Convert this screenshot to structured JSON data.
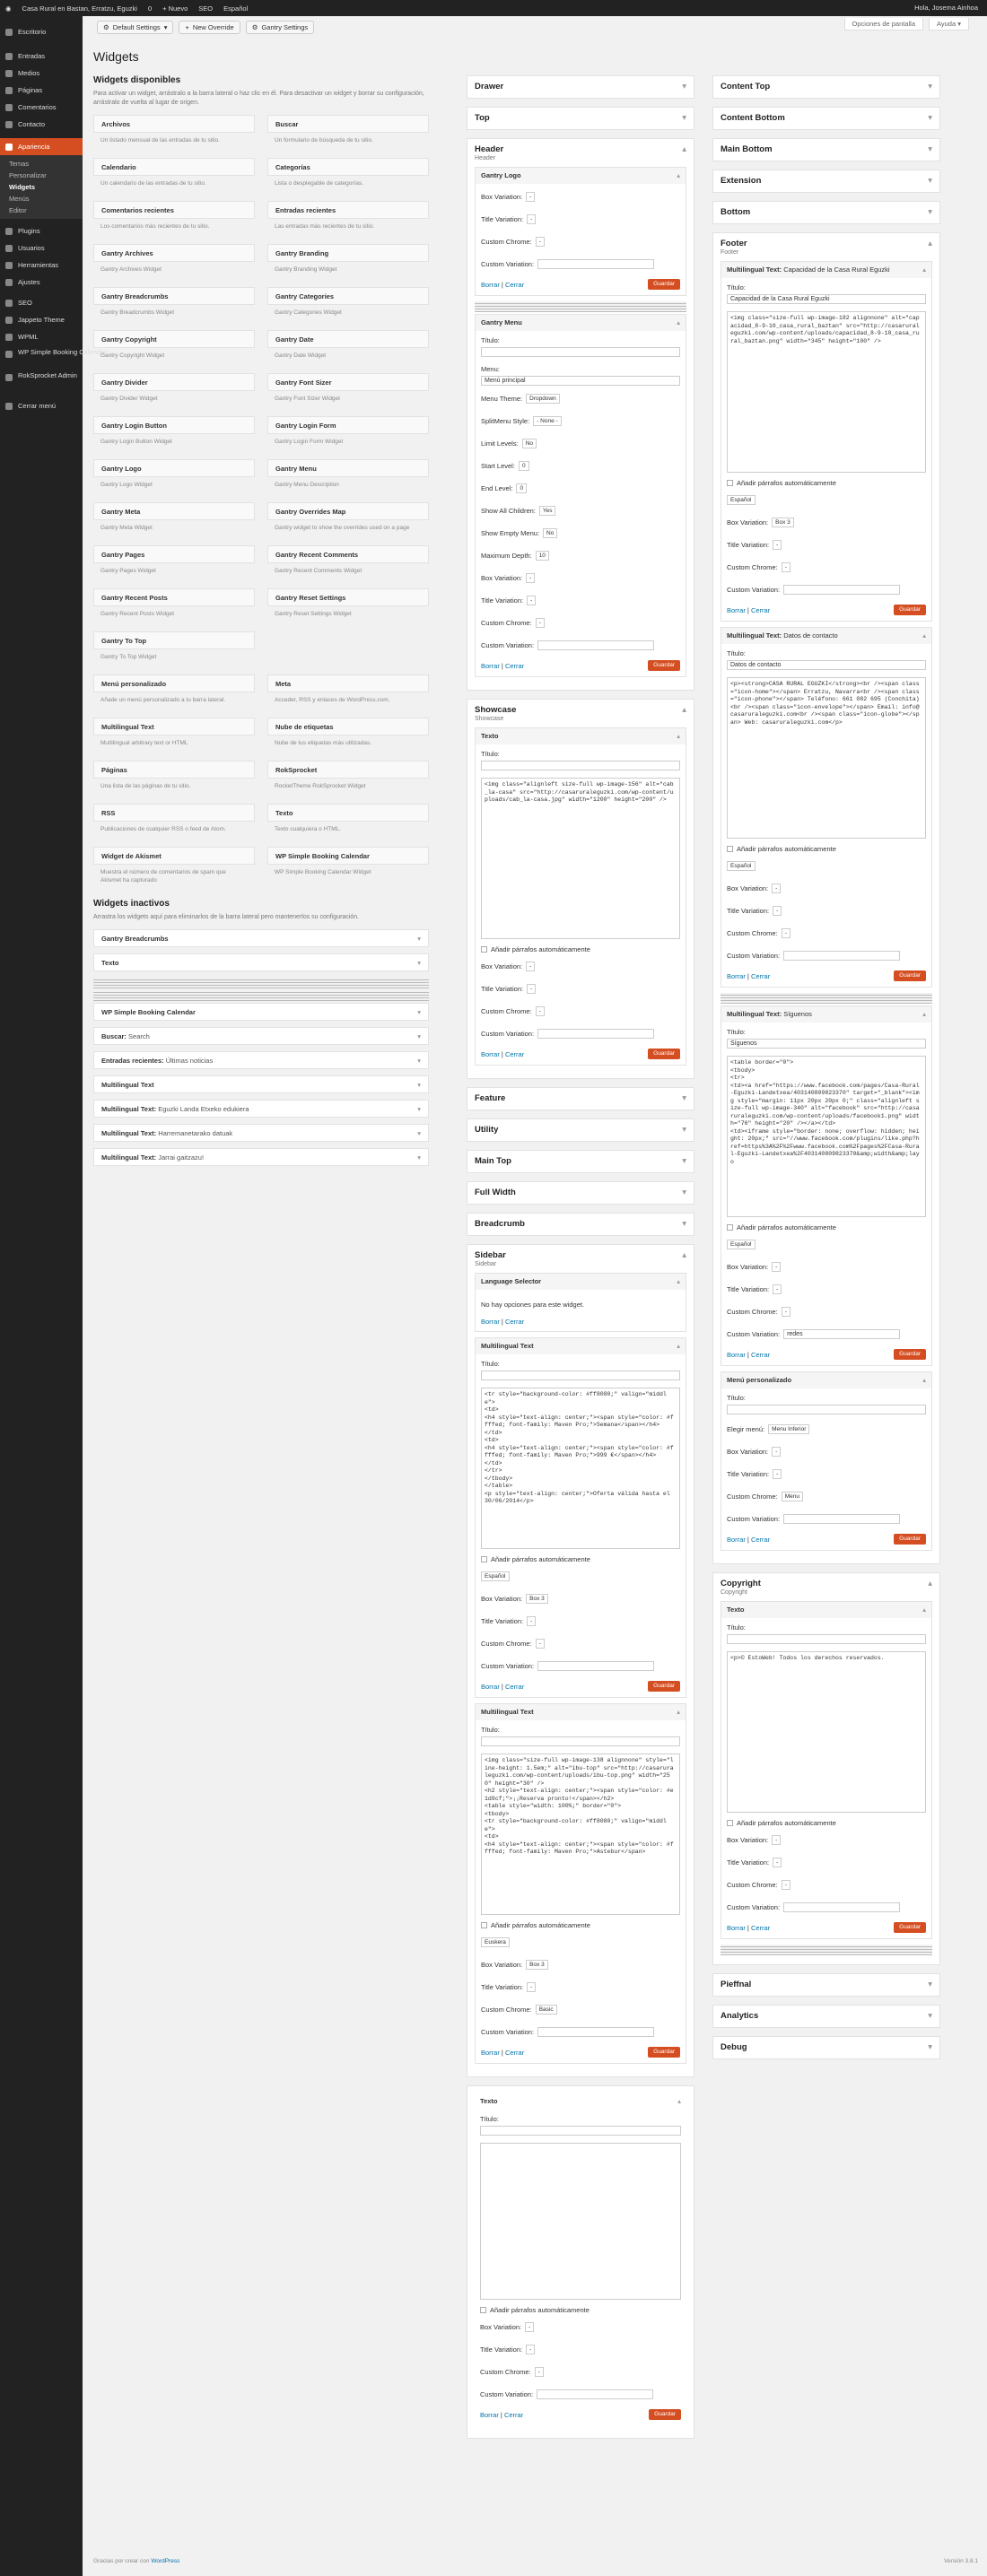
{
  "adminbar": {
    "site": "Casa Rural en Bastan, Erratzu, Eguzki",
    "comments": "0",
    "new": "+ Nuevo",
    "seo": "SEO",
    "lang": "Español",
    "howdy": "Hola, Josema Ainhoa"
  },
  "menu": [
    "Escritorio",
    "Entradas",
    "Medios",
    "Páginas",
    "Comentarios",
    "Contacto",
    "Apariencia",
    "Plugins",
    "Usuarios",
    "Herramientas",
    "Ajustes",
    "SEO",
    "Jappeto Theme",
    "WPML",
    "WP Simple Booking Calendar",
    "RokSprocket Admin",
    "Cerrar menú"
  ],
  "submenu": [
    "Temas",
    "Personalizar",
    "Widgets",
    "Menús",
    "Editor"
  ],
  "toolbar": {
    "default": "Default Settings",
    "override": "New Override",
    "gantry": "Gantry Settings"
  },
  "screen_options": "Opciones de pantalla",
  "help": "Ayuda ▾",
  "page_title": "Widgets",
  "available": {
    "heading": "Widgets disponibles",
    "desc": "Para activar un widget, arrástralo a la barra lateral o haz clic en él. Para desactivar un widget y borrar su configuración, arrástralo de vuelta al lugar de origen.",
    "items": [
      {
        "t": "Archivos",
        "d": "Un listado mensual de las entradas de tu sitio."
      },
      {
        "t": "Buscar",
        "d": "Un formulario de búsqueda de tu sitio."
      },
      {
        "t": "Calendario",
        "d": "Un calendario de las entradas de tu sitio."
      },
      {
        "t": "Categorías",
        "d": "Lista o desplegable de categorías."
      },
      {
        "t": "Comentarios recientes",
        "d": "Los comentarios más recientes de tu sitio."
      },
      {
        "t": "Entradas recientes",
        "d": "Las entradas más recientes de tu sitio."
      },
      {
        "t": "Gantry Archives",
        "d": "Gantry Archives Widget"
      },
      {
        "t": "Gantry Branding",
        "d": "Gantry Branding Widget"
      },
      {
        "t": "Gantry Breadcrumbs",
        "d": "Gantry Breadcrumbs Widget"
      },
      {
        "t": "Gantry Categories",
        "d": "Gantry Categories Widget"
      },
      {
        "t": "Gantry Copyright",
        "d": "Gantry Copyright Widget"
      },
      {
        "t": "Gantry Date",
        "d": "Gantry Date Widget"
      },
      {
        "t": "Gantry Divider",
        "d": "Gantry Divider Widget"
      },
      {
        "t": "Gantry Font Sizer",
        "d": "Gantry Font Sizer Widget"
      },
      {
        "t": "Gantry Login Button",
        "d": "Gantry Login Button Widget"
      },
      {
        "t": "Gantry Login Form",
        "d": "Gantry Login Form Widget"
      },
      {
        "t": "Gantry Logo",
        "d": "Gantry Logo Widget"
      },
      {
        "t": "Gantry Menu",
        "d": "Gantry Menu Description"
      },
      {
        "t": "Gantry Meta",
        "d": "Gantry Meta Widget"
      },
      {
        "t": "Gantry Overrides Map",
        "d": "Gantry widget to show the overrides used on a page"
      },
      {
        "t": "Gantry Pages",
        "d": "Gantry Pages Widget"
      },
      {
        "t": "Gantry Recent Comments",
        "d": "Gantry Recent Comments Widget"
      },
      {
        "t": "Gantry Recent Posts",
        "d": "Gantry Recent Posts Widget"
      },
      {
        "t": "Gantry Reset Settings",
        "d": "Gantry Reset Settings Widget"
      },
      {
        "t": "Gantry To Top",
        "d": "Gantry To Top Widget"
      },
      {
        "t": "",
        "d": ""
      },
      {
        "t": "Menú personalizado",
        "d": "Añade un menú personalizado a tu barra lateral."
      },
      {
        "t": "Meta",
        "d": "Acceder, RSS y enlaces de WordPress.com."
      },
      {
        "t": "Multilingual Text",
        "d": "Multilingual arbitrary text or HTML"
      },
      {
        "t": "Nube de etiquetas",
        "d": "Nube de tus etiquetas más utilizadas."
      },
      {
        "t": "Páginas",
        "d": "Una lista de las páginas de tu sitio."
      },
      {
        "t": "RokSprocket",
        "d": "RocketTheme RokSprocket Widget"
      },
      {
        "t": "RSS",
        "d": "Publicaciones de cualquier RSS o feed de Atom."
      },
      {
        "t": "Texto",
        "d": "Texto cualquiera o HTML."
      },
      {
        "t": "Widget de Akismet",
        "d": "Muestra el número de comentarios de spam que Akismet ha capturado"
      },
      {
        "t": "WP Simple Booking Calendar",
        "d": "WP Simple Booking Calendar Widget"
      }
    ]
  },
  "inactive": {
    "heading": "Widgets inactivos",
    "desc": "Arrastra los widgets aquí para eliminarlos de la barra lateral pero mantenerlos su configuración.",
    "items": [
      {
        "t": "Gantry Breadcrumbs",
        "s": ""
      },
      {
        "t": "Texto",
        "s": ""
      },
      {
        "t": "WP Simple Booking Calendar",
        "s": ""
      },
      {
        "t": "Buscar:",
        "s": "Search"
      },
      {
        "t": "Entradas recientes:",
        "s": "Últimas noticias"
      },
      {
        "t": "Multilingual Text",
        "s": ""
      },
      {
        "t": "Multilingual Text:",
        "s": "Eguzki Landa Etxeko edukiera"
      },
      {
        "t": "Multilingual Text:",
        "s": "Harremanetarako datuak"
      },
      {
        "t": "Multilingual Text:",
        "s": "Jarrai gaitzazu!"
      }
    ]
  },
  "labels": {
    "box": "Box Variation:",
    "title_var": "Title Variation:",
    "chrome": "Custom Chrome:",
    "custom_var": "Custom Variation:",
    "delete": "Borrar",
    "close": "Cerrar",
    "save": "Guardar",
    "title": "Título:",
    "auto_p": "Añadir párrafos automáticamente",
    "dash": "-",
    "menu_label": "Menu:",
    "theme": "Menu Theme:",
    "split": "SplitMenu Style:",
    "limit": "Limit Levels:",
    "start": "Start Level:",
    "end": "End Level:",
    "showall": "Show All Children:",
    "showempty": "Show Empty Menu:",
    "maxdepth": "Maximum Depth:",
    "elegir": "Elegir menú:",
    "no_opts": "No hay opciones para este widget."
  },
  "col2": {
    "drawer": "Drawer",
    "top": "Top",
    "header": "Header",
    "logo": "Gantry Logo",
    "gmenu": {
      "title": "Gantry Menu",
      "menu": "Menú principal",
      "theme": "Dropdown",
      "split": "- None -",
      "limit": "No",
      "start": "0",
      "end": "0",
      "showall": "Yes",
      "showempty": "No",
      "maxdepth": "10"
    },
    "showcase": "Showcase",
    "texto": "Texto",
    "showcase_ta": "<img class=\"alignleft size-full wp-image-156\" alt=\"cab_la-casa\" src=\"http://casaruraleguzki.com/wp-content/uploads/cab_la-casa.jpg\" width=\"1200\" height=\"200\" />",
    "others": [
      "Feature",
      "Utility",
      "Main Top",
      "Full Width",
      "Breadcrumb"
    ],
    "sidebar": "Sidebar",
    "lang_sw": "Language Selector",
    "mt": "Multilingual Text",
    "mt1_ta": "<tr style=\"background-color: #ff8080;\" valign=\"middle\">\n<td>\n<h4 style=\"text-align: center;\"><span style=\"color: #ffffed; font-family: Maven Pro;\">Semana</span></h4>\n</td>\n<td>\n<h4 style=\"text-align: center;\"><span style=\"color: #ffffed; font-family: Maven Pro;\">999 €</span></h4>\n</td>\n</tr>\n</tbody>\n</table>\n<p style=\"text-align: center;\">Oferta válida hasta el 30/06/2014</p>",
    "mt1_lang": "Español",
    "mt1_box": "Box 3",
    "mt2_ta": "<img class=\"size-full wp-image-138 alignnone\" style=\"line-height: 1.5em;\" alt=\"ibu-top\" src=\"http://casaruraleguzki.com/wp-content/uploads/ibu-top.png\" width=\"250\" height=\"30\" />\n<h2 style=\"text-align: center;\"><span style=\"color: #e1d9cf;\">¡¡Reserva pronto!</span></h2>\n<table style=\"width: 100%;\" border=\"0\">\n<tbody>\n<tr style=\"background-color: #ff8080;\" valign=\"middle\">\n<td>\n<h4 style=\"text-align: center;\"><span style=\"color: #ffffed; font-family: Maven Pro;\">Astebur</span>",
    "mt2_lang": "Euskera",
    "mt2_box": "Box 3",
    "mt2_chrome": "Basic",
    "texto2": "Texto"
  },
  "col3": {
    "ct": "Content Top",
    "cb": "Content Bottom",
    "mb": "Main Bottom",
    "ext": "Extension",
    "bottom": "Bottom",
    "footer": "Footer",
    "f1": {
      "head": "Multilingual Text:",
      "sub": "Capacidad de la Casa Rural Eguzki",
      "title": "Capacidad de la Casa Rural Eguzki",
      "ta": "<img class=\"size-full wp-image-182 alignnone\" alt=\"capacidad_8-9-10_casa_rural_baztan\" src=\"http://casaruraleguzki.com/wp-content/uploads/capacidad_8-9-10_casa_rural_baztan.png\" width=\"345\" height=\"100\" />",
      "lang": "Español",
      "box": "Box 3"
    },
    "f2": {
      "head": "Multilingual Text:",
      "sub": "Datos de contacto",
      "title": "Datos de contacto",
      "ta": "<p><strong>CASA RURAL EGUZKI</strong><br /><span class=\"icon-home\"></span> Erratzu, Navarra<br /><span class=\"icon-phone\"></span> Teléfono: 661 082 695 (Conchita)<br /><span class=\"icon-envelope\"></span> Email: info@casaruraleguzki.com<br /><span class=\"icon-globe\"></span> Web: casaruraleguzki.com</p>",
      "lang": "Español"
    },
    "f3": {
      "head": "Multilingual Text:",
      "sub": "Síguenos",
      "title": "Síguenos",
      "ta": "<table border=\"0\">\n<tbody>\n<tr>\n<td><a href=\"https://www.facebook.com/pages/Casa-Rural-Eguzki-Landetxea/403140809823370\" target=\"_blank\"><img style=\"margin: 11px 20px 20px 0;\" class=\"alignleft size-full wp-image-340\" alt=\"facebook\" src=\"http://casaruraleguzki.com/wp-content/uploads/facebook1.png\" width=\"76\" height=\"20\" /></a></td>\n<td><iframe style=\"border: none; overflow: hidden; height: 20px;\" src=\"//www.facebook.com/plugins/like.php?href=https%3A%2F%2Fwww.facebook.com%2Fpages%2FCasa-Rural-Eguzki-Landetxea%2F403140809823370&amp;width&amp;layo",
      "lang": "Español",
      "custom": "redes"
    },
    "menu": {
      "head": "Menú personalizado",
      "elegir": "Menu Inferior",
      "chrome": "Menu"
    },
    "copyright": "Copyright",
    "copy_ta": "<p>© EstoWeb! Todos los derechos reservados.",
    "others": [
      "Pieffnal",
      "Analytics",
      "Debug"
    ]
  },
  "footer": {
    "text": "Gracias por crear con",
    "link": "WordPress",
    "version": "Versión 3.8.1"
  }
}
